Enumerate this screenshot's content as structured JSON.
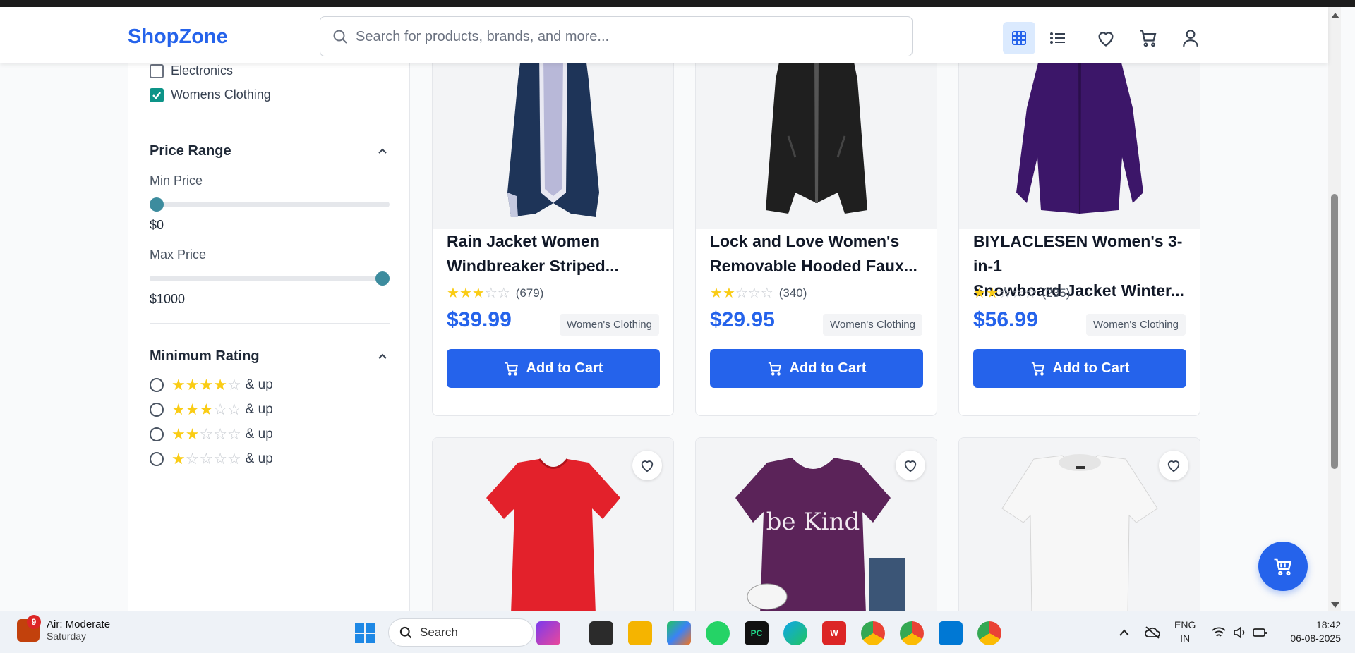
{
  "header": {
    "logo": "ShopZone",
    "search_placeholder": "Search for products, brands, and more..."
  },
  "sidebar": {
    "categories": [
      {
        "label": "Electronics",
        "checked": false
      },
      {
        "label": "Womens Clothing",
        "checked": true
      }
    ],
    "price": {
      "title": "Price Range",
      "min_label": "Min Price",
      "min_value": "$0",
      "max_label": "Max Price",
      "max_value": "$1000"
    },
    "rating": {
      "title": "Minimum Rating",
      "options": [
        {
          "stars": 4,
          "suffix": "& up"
        },
        {
          "stars": 3,
          "suffix": "& up"
        },
        {
          "stars": 2,
          "suffix": "& up"
        },
        {
          "stars": 1,
          "suffix": "& up"
        }
      ]
    }
  },
  "products": [
    {
      "title_line1": "Rain Jacket Women",
      "title_line2": "Windbreaker Striped...",
      "stars": 3,
      "reviews": "(679)",
      "price": "$39.99",
      "category": "Women's Clothing",
      "button": "Add to Cart",
      "image": "navy-rain-jacket"
    },
    {
      "title_line1": "Lock and Love Women's",
      "title_line2": "Removable Hooded Faux...",
      "stars": 2,
      "reviews": "(340)",
      "price": "$29.95",
      "category": "Women's Clothing",
      "button": "Add to Cart",
      "image": "black-leather-jacket"
    },
    {
      "title_line1": "BIYLACLESEN Women's 3-in-1",
      "title_line2": "Snowboard Jacket Winter...",
      "stars": 2,
      "reviews": "(235)",
      "price": "$56.99",
      "category": "Women's Clothing",
      "button": "Add to Cart",
      "image": "purple-jacket"
    },
    {
      "image": "red-tshirt"
    },
    {
      "image": "purple-be-kind-tshirt",
      "image_text": "be Kind"
    },
    {
      "image": "white-top"
    }
  ],
  "taskbar": {
    "weather_title": "Air: Moderate",
    "weather_sub": "Saturday",
    "weather_badge": "9",
    "search_label": "Search",
    "lang_top": "ENG",
    "lang_bottom": "IN",
    "time": "18:42",
    "date": "06-08-2025"
  },
  "colors": {
    "brand": "#2563eb",
    "accent": "#0d9488",
    "star": "#facc15"
  }
}
